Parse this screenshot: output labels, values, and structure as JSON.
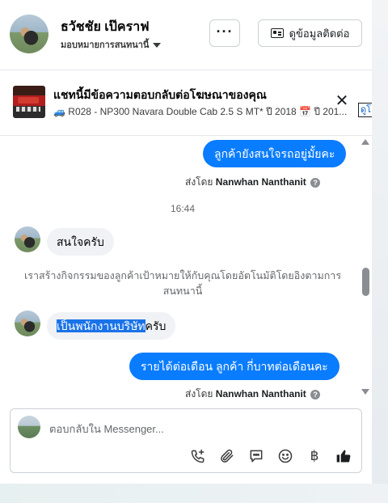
{
  "header": {
    "name": "ธวัชชัย เป๊คราฟ",
    "assignment": "มอบหมายการสนทนานี้",
    "more_label": "···",
    "contact_label": "ดูข้อมูลติดต่อ"
  },
  "ad_banner": {
    "title": "แชทนี้มีข้อความตอบกลับต่อโฆษณาของคุณ",
    "subtitle": "🚙 R028 - NP300 Navara Double Cab 2.5 S MT* ปี 2018 📅 ปี 201...",
    "link_text": "ดูโ",
    "close": "✕"
  },
  "messages": {
    "m1": "ลูกค้ายังสนใจรถอยู่มั้ยคะ",
    "sent_by_label": "ส่งโดย",
    "sender": "Nanwhan Nanthanit",
    "info": "?",
    "time": "16:44",
    "m2": "สนใจครับ",
    "system": "เราสร้างกิจกรรมของลูกค้าเป้าหมายให้กับคุณโดยอัตโนมัติโดยอิงตามการสนทนานี้",
    "m3_highlight": "เป็นพนักงานบริษัท",
    "m3_rest": "ครับ",
    "m4": "รายได้ต่อเดือน  ลูกค้า   กี่บาทต่อเดือนคะ"
  },
  "composer": {
    "placeholder": "ตอบกลับใน Messenger...",
    "baht": "฿"
  },
  "colors": {
    "accent_blue": "#0a7cff",
    "incoming_bubble": "#f0f2f5",
    "link_blue": "#0a66c2"
  },
  "icons": [
    "more-icon",
    "contact-card-icon",
    "close-icon",
    "call-icon",
    "attach-icon",
    "saved-reply-icon",
    "emoji-icon",
    "baht-icon",
    "like-icon"
  ]
}
